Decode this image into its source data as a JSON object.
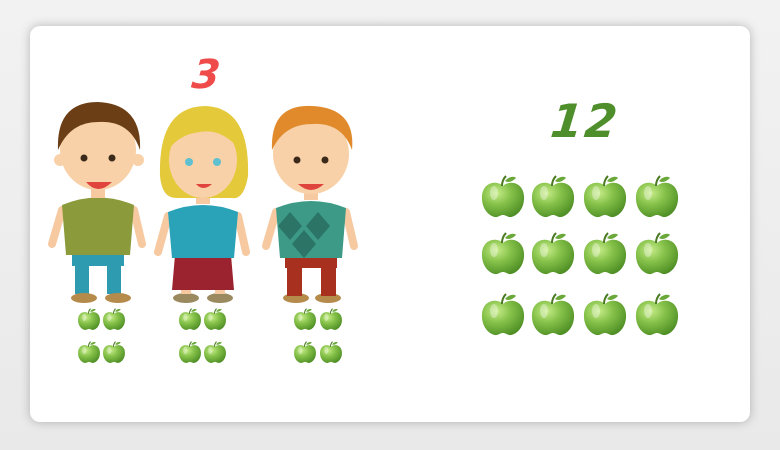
{
  "group_label": "3",
  "total_label": "12",
  "children": [
    {
      "name": "boy-brown-hair",
      "apples": 4
    },
    {
      "name": "girl-blonde-hair",
      "apples": 4
    },
    {
      "name": "boy-red-hair",
      "apples": 4
    }
  ],
  "total_apples": 12,
  "colors": {
    "apple_green": "#7fbf45",
    "number_red": "#ef4b4b",
    "number_green": "#4e8f2c"
  },
  "icons": [
    "apple-icon",
    "child-illustration"
  ]
}
